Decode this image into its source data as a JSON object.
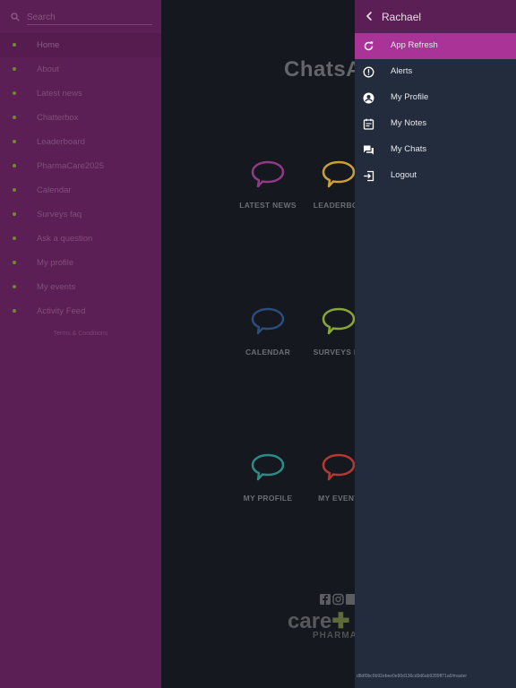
{
  "left_menu": {
    "search_placeholder": "Search",
    "items": [
      {
        "label": "Home"
      },
      {
        "label": "About"
      },
      {
        "label": "Latest news"
      },
      {
        "label": "Chatterbox"
      },
      {
        "label": "Leaderboard"
      },
      {
        "label": "PharmaCare2025"
      },
      {
        "label": "Calendar"
      },
      {
        "label": "Surveys faq"
      },
      {
        "label": "Ask a question"
      },
      {
        "label": "My profile"
      },
      {
        "label": "My events"
      },
      {
        "label": "Activity Feed"
      }
    ],
    "terms": "Terms & Conditions",
    "active_item": "Home"
  },
  "main": {
    "logo": "ChatsA",
    "tiles": [
      {
        "label": "LATEST NEWS",
        "color": "#8f3a86"
      },
      {
        "label": "LEADERBOA",
        "color": "#c9a03a"
      },
      {
        "label": "CALENDAR",
        "color": "#2b4d7a"
      },
      {
        "label": "SURVEYS FA",
        "color": "#8aa636"
      },
      {
        "label": "MY PROFILE",
        "color": "#2b8b86"
      },
      {
        "label": "MY EVENT",
        "color": "#b33a34"
      }
    ],
    "footer": {
      "brand": "care",
      "sub": "PHARMAC"
    }
  },
  "right_panel": {
    "user": "Rachael",
    "items": [
      {
        "label": "App Refresh",
        "icon": "refresh-icon"
      },
      {
        "label": "Alerts",
        "icon": "alert-icon"
      },
      {
        "label": "My Profile",
        "icon": "account-circle-icon"
      },
      {
        "label": "My Notes",
        "icon": "notes-icon"
      },
      {
        "label": "My Chats",
        "icon": "chats-icon"
      },
      {
        "label": "Logout",
        "icon": "logout-icon"
      }
    ],
    "active_item": "App Refresh",
    "build": "d8df0bc9b92ebee0e90d136cd9d6ab9289ff71a0/master"
  },
  "colors": {
    "purple": "#5c1f55",
    "active_pink": "#a93397",
    "panel_navy": "#232c3d",
    "dark_bg": "#15181f"
  }
}
